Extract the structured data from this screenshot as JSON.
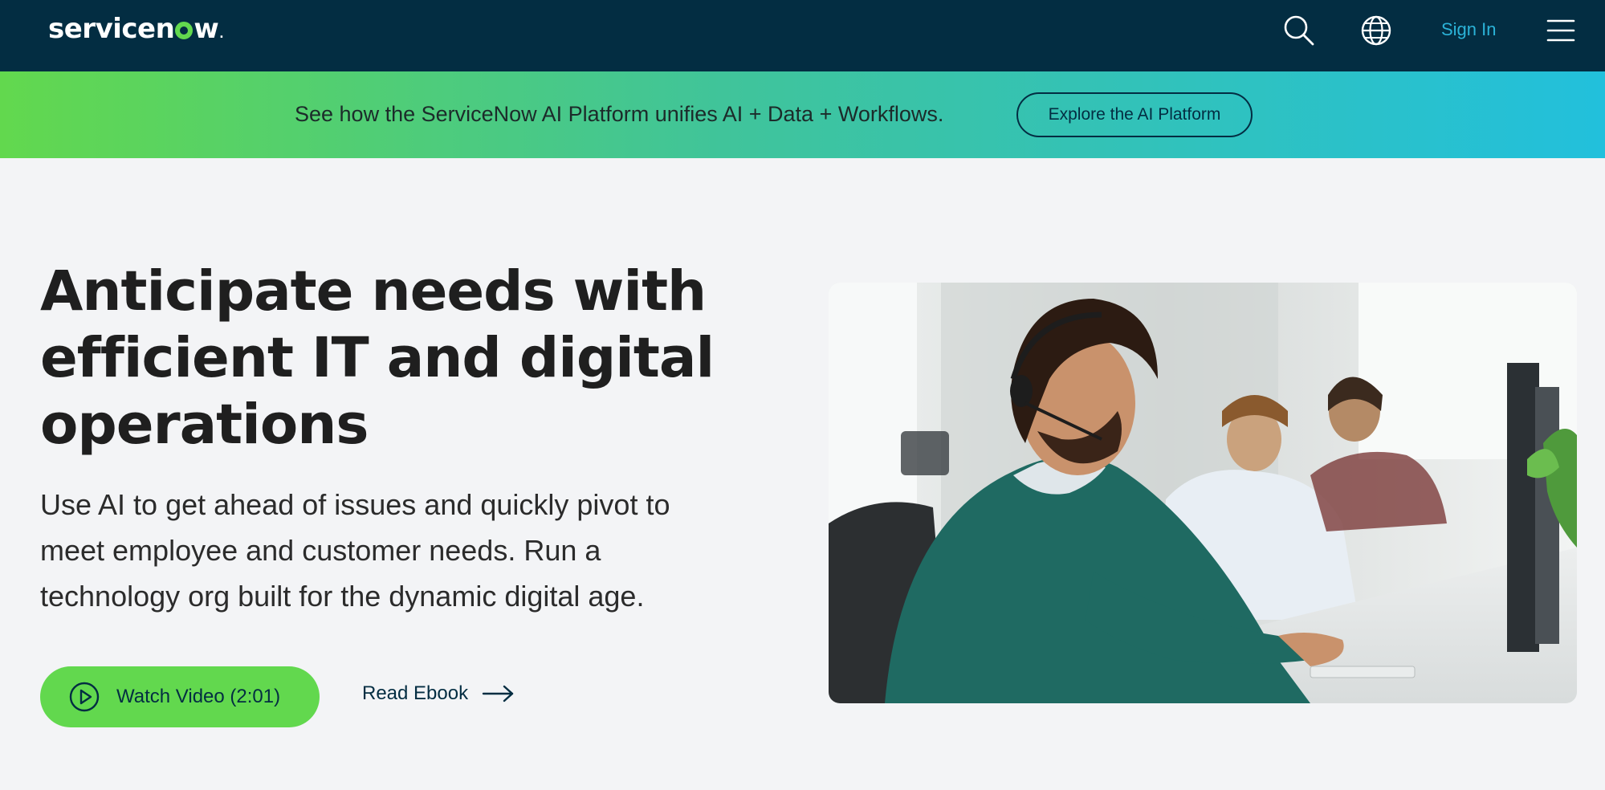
{
  "header": {
    "logo_text": "servicenow",
    "sign_in_label": "Sign In",
    "icons": [
      "search-icon",
      "globe-icon",
      "hamburger-menu-icon"
    ]
  },
  "banner": {
    "text": "See how the ServiceNow AI Platform unifies AI + Data + Workflows.",
    "button_label": "Explore the AI Platform"
  },
  "hero": {
    "title_lines": [
      "Anticipate needs with",
      "efficient IT and digital",
      "operations"
    ],
    "description_lines": [
      "Use AI to get ahead of issues and quickly pivot to",
      "meet employee and customer needs. Run a",
      "technology org built for the dynamic digital age."
    ],
    "watch_button_label": "Watch Video (2:01)",
    "ebook_link_label": "Read Ebook"
  },
  "colors": {
    "nav_bg": "#032d42",
    "brand_green": "#62d84e",
    "banner_gradient_end": "#22c0dc",
    "sign_in": "#2bb3d8",
    "page_bg": "#f3f4f6"
  }
}
